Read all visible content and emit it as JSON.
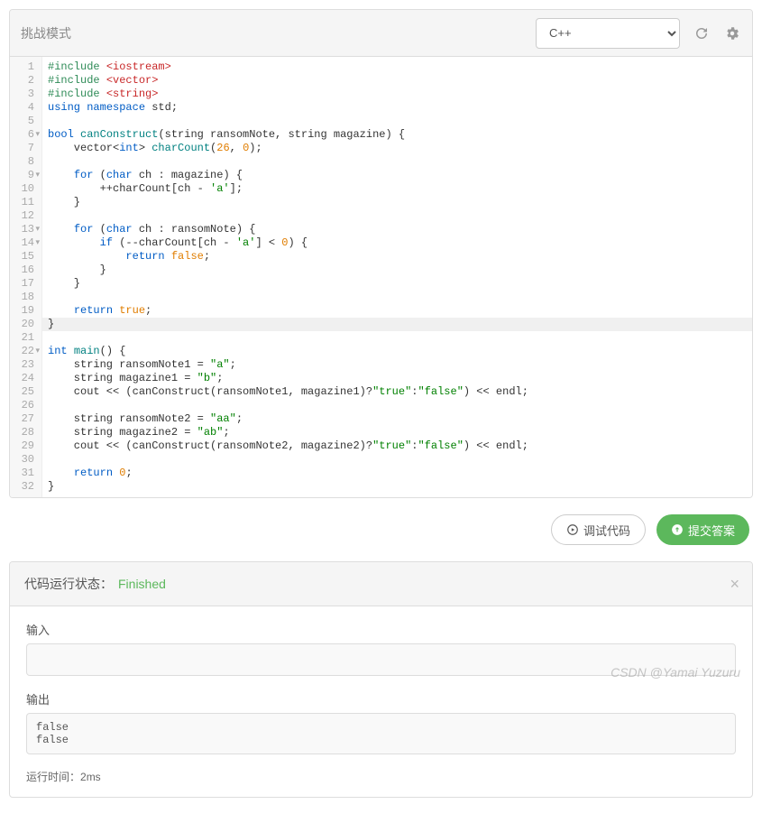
{
  "header": {
    "title": "挑战模式",
    "language": "C++"
  },
  "code": {
    "lines": [
      {
        "n": 1,
        "html": "<span class='kw-green'>#include</span> <span class='kw-red'>&lt;iostream&gt;</span>"
      },
      {
        "n": 2,
        "html": "<span class='kw-green'>#include</span> <span class='kw-red'>&lt;vector&gt;</span>"
      },
      {
        "n": 3,
        "html": "<span class='kw-green'>#include</span> <span class='kw-red'>&lt;string&gt;</span>"
      },
      {
        "n": 4,
        "html": "<span class='kw-blue'>using</span> <span class='kw-blue'>namespace</span> std;"
      },
      {
        "n": 5,
        "html": ""
      },
      {
        "n": 6,
        "fold": true,
        "html": "<span class='kw-blue'>bool</span> <span class='kw-teal'>canConstruct</span>(string ransomNote, string magazine) {"
      },
      {
        "n": 7,
        "html": "    vector&lt;<span class='kw-blue'>int</span>&gt; <span class='kw-teal'>charCount</span>(<span class='kw-orange'>26</span>, <span class='kw-orange'>0</span>);"
      },
      {
        "n": 8,
        "html": ""
      },
      {
        "n": 9,
        "fold": true,
        "html": "    <span class='kw-blue'>for</span> (<span class='kw-blue'>char</span> ch : magazine) {"
      },
      {
        "n": 10,
        "html": "        ++charCount[ch - <span class='kw-str'>'a'</span>];"
      },
      {
        "n": 11,
        "html": "    }"
      },
      {
        "n": 12,
        "html": ""
      },
      {
        "n": 13,
        "fold": true,
        "html": "    <span class='kw-blue'>for</span> (<span class='kw-blue'>char</span> ch : ransomNote) {"
      },
      {
        "n": 14,
        "fold": true,
        "html": "        <span class='kw-blue'>if</span> (--charCount[ch - <span class='kw-str'>'a'</span>] &lt; <span class='kw-orange'>0</span>) {"
      },
      {
        "n": 15,
        "html": "            <span class='kw-blue'>return</span> <span class='kw-orange'>false</span>;"
      },
      {
        "n": 16,
        "html": "        }"
      },
      {
        "n": 17,
        "html": "    }"
      },
      {
        "n": 18,
        "html": ""
      },
      {
        "n": 19,
        "html": "    <span class='kw-blue'>return</span> <span class='kw-orange'>true</span>;"
      },
      {
        "n": 20,
        "hl": true,
        "html": "}"
      },
      {
        "n": 21,
        "html": ""
      },
      {
        "n": 22,
        "fold": true,
        "html": "<span class='kw-blue'>int</span> <span class='kw-teal'>main</span>() {"
      },
      {
        "n": 23,
        "html": "    string ransomNote1 = <span class='kw-str'>\"a\"</span>;"
      },
      {
        "n": 24,
        "html": "    string magazine1 = <span class='kw-str'>\"b\"</span>;"
      },
      {
        "n": 25,
        "html": "    cout &lt;&lt; (canConstruct(ransomNote1, magazine1)?<span class='kw-str'>\"true\"</span>:<span class='kw-str'>\"false\"</span>) &lt;&lt; endl;"
      },
      {
        "n": 26,
        "html": ""
      },
      {
        "n": 27,
        "html": "    string ransomNote2 = <span class='kw-str'>\"aa\"</span>;"
      },
      {
        "n": 28,
        "html": "    string magazine2 = <span class='kw-str'>\"ab\"</span>;"
      },
      {
        "n": 29,
        "html": "    cout &lt;&lt; (canConstruct(ransomNote2, magazine2)?<span class='kw-str'>\"true\"</span>:<span class='kw-str'>\"false\"</span>) &lt;&lt; endl;"
      },
      {
        "n": 30,
        "html": ""
      },
      {
        "n": 31,
        "html": "    <span class='kw-blue'>return</span> <span class='kw-orange'>0</span>;"
      },
      {
        "n": 32,
        "html": "}"
      }
    ]
  },
  "actions": {
    "debug": "调试代码",
    "submit": "提交答案"
  },
  "result": {
    "label": "代码运行状态：",
    "status": "Finished",
    "input_label": "输入",
    "input_value": "",
    "output_label": "输出",
    "output_value": "false\nfalse",
    "runtime_label": "运行时间：",
    "runtime_value": "2ms"
  },
  "watermark": "CSDN @Yamai Yuzuru"
}
